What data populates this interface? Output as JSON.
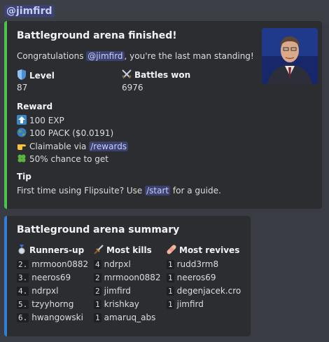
{
  "reply": {
    "mention": "@jimfird"
  },
  "embed1": {
    "title": "Battleground arena finished!",
    "congrats_prefix": "Congratulations ",
    "congrats_mention": "@jimfird",
    "congrats_suffix": ", you're the last man standing!",
    "level_label": "Level",
    "level_value": "87",
    "battles_label": "Battles won",
    "battles_value": "6976",
    "reward_label": "Reward",
    "reward_exp": "100 EXP",
    "reward_pack": "100 PACK ($0.0191)",
    "claim_prefix": "Claimable via ",
    "claim_cmd": "/rewards",
    "chance": "50% chance to get",
    "tip_label": "Tip",
    "tip_prefix": "First time using Flipsuite? Use ",
    "tip_cmd": "/start",
    "tip_suffix": " for a guide."
  },
  "embed2": {
    "title": "Battleground arena summary",
    "col1_label": "Runners-up",
    "col2_label": "Most kills",
    "col3_label": "Most revives",
    "runners_up": [
      {
        "n": "2.",
        "name": "mrmoon0882"
      },
      {
        "n": "3.",
        "name": "neeros69"
      },
      {
        "n": "4.",
        "name": "ndrpxl"
      },
      {
        "n": "5.",
        "name": "tzyyhorng"
      },
      {
        "n": "6.",
        "name": "hwangowski"
      }
    ],
    "most_kills": [
      {
        "n": "4",
        "name": "ndrpxl"
      },
      {
        "n": "2",
        "name": "mrmoon0882"
      },
      {
        "n": "2",
        "name": "jimfird"
      },
      {
        "n": "1",
        "name": "krishkay"
      },
      {
        "n": "1",
        "name": "amaruq_abs"
      }
    ],
    "most_revives": [
      {
        "n": "1",
        "name": "rudd3rm8"
      },
      {
        "n": "1",
        "name": "neeros69"
      },
      {
        "n": "1",
        "name": "degenjacek.cro"
      },
      {
        "n": "1",
        "name": "jimfird"
      }
    ]
  },
  "colors": {
    "embed1_accent": "#4ac44a",
    "embed2_accent": "#2f7fd8",
    "mention_bg": "#3c4270"
  }
}
